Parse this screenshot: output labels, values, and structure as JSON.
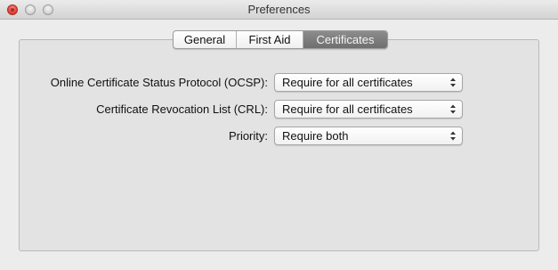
{
  "window": {
    "title": "Preferences"
  },
  "tabs": [
    {
      "label": "General",
      "selected": false
    },
    {
      "label": "First Aid",
      "selected": false
    },
    {
      "label": "Certificates",
      "selected": true
    }
  ],
  "settings": {
    "ocsp": {
      "label": "Online Certificate Status Protocol (OCSP):",
      "value": "Require for all certificates"
    },
    "crl": {
      "label": "Certificate Revocation List (CRL):",
      "value": "Require for all certificates"
    },
    "priority": {
      "label": "Priority:",
      "value": "Require both"
    }
  },
  "icons": {
    "close": "close-icon",
    "minimize": "minimize-icon",
    "zoom": "zoom-icon",
    "popup_arrows": "chevron-up-down-icon"
  },
  "colors": {
    "selected_tab": "#7a7a7a",
    "close_button": "#e0443a"
  }
}
